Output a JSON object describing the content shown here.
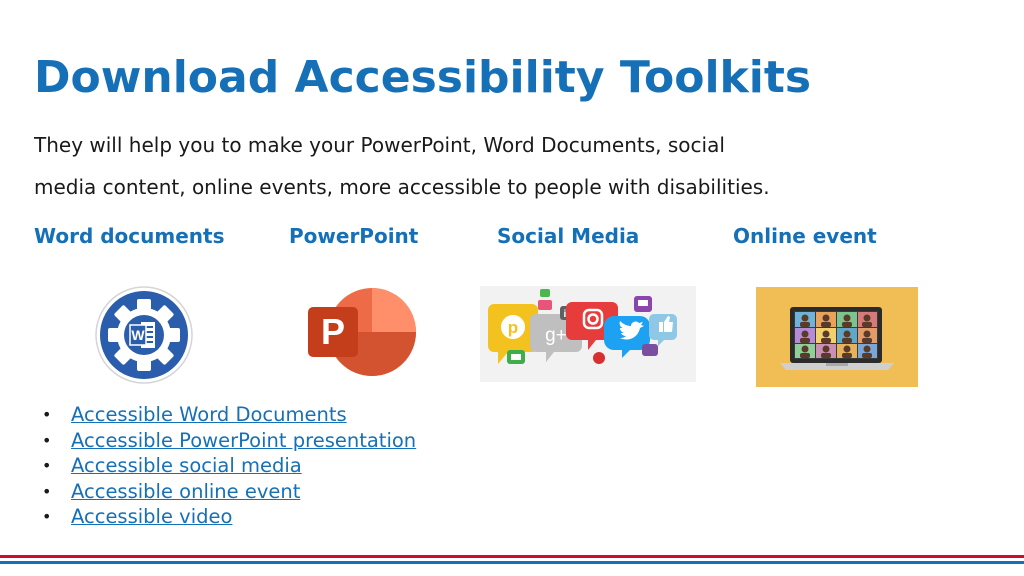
{
  "slide": {
    "title": "Download Accessibility Toolkits",
    "intro_line1": "They will help you to make your PowerPoint, Word Documents, social",
    "intro_line2": "media content, online events, more accessible to people with disabilities."
  },
  "categories": [
    {
      "label": "Word documents",
      "icon": "word-gear-icon"
    },
    {
      "label": "PowerPoint",
      "icon": "powerpoint-logo-icon"
    },
    {
      "label": "Social Media",
      "icon": "social-media-bubbles-icon"
    },
    {
      "label": "Online event",
      "icon": "video-call-laptop-icon"
    }
  ],
  "word_icon_letter": "W",
  "ppt_icon_letter": "P",
  "social_icon_texts": [
    "g+",
    "in"
  ],
  "links": [
    {
      "label": "Accessible Word Documents"
    },
    {
      "label": "Accessible PowerPoint presentation "
    },
    {
      "label": "Accessible social media"
    },
    {
      "label": "Accessible online event"
    },
    {
      "label": "Accessible video"
    }
  ],
  "colors": {
    "accent_blue": "#1570b7",
    "rule_red": "#c8102e",
    "rule_blue": "#1570b7",
    "ppt_orange": "#d04423",
    "online_event_bg": "#f0be55"
  }
}
